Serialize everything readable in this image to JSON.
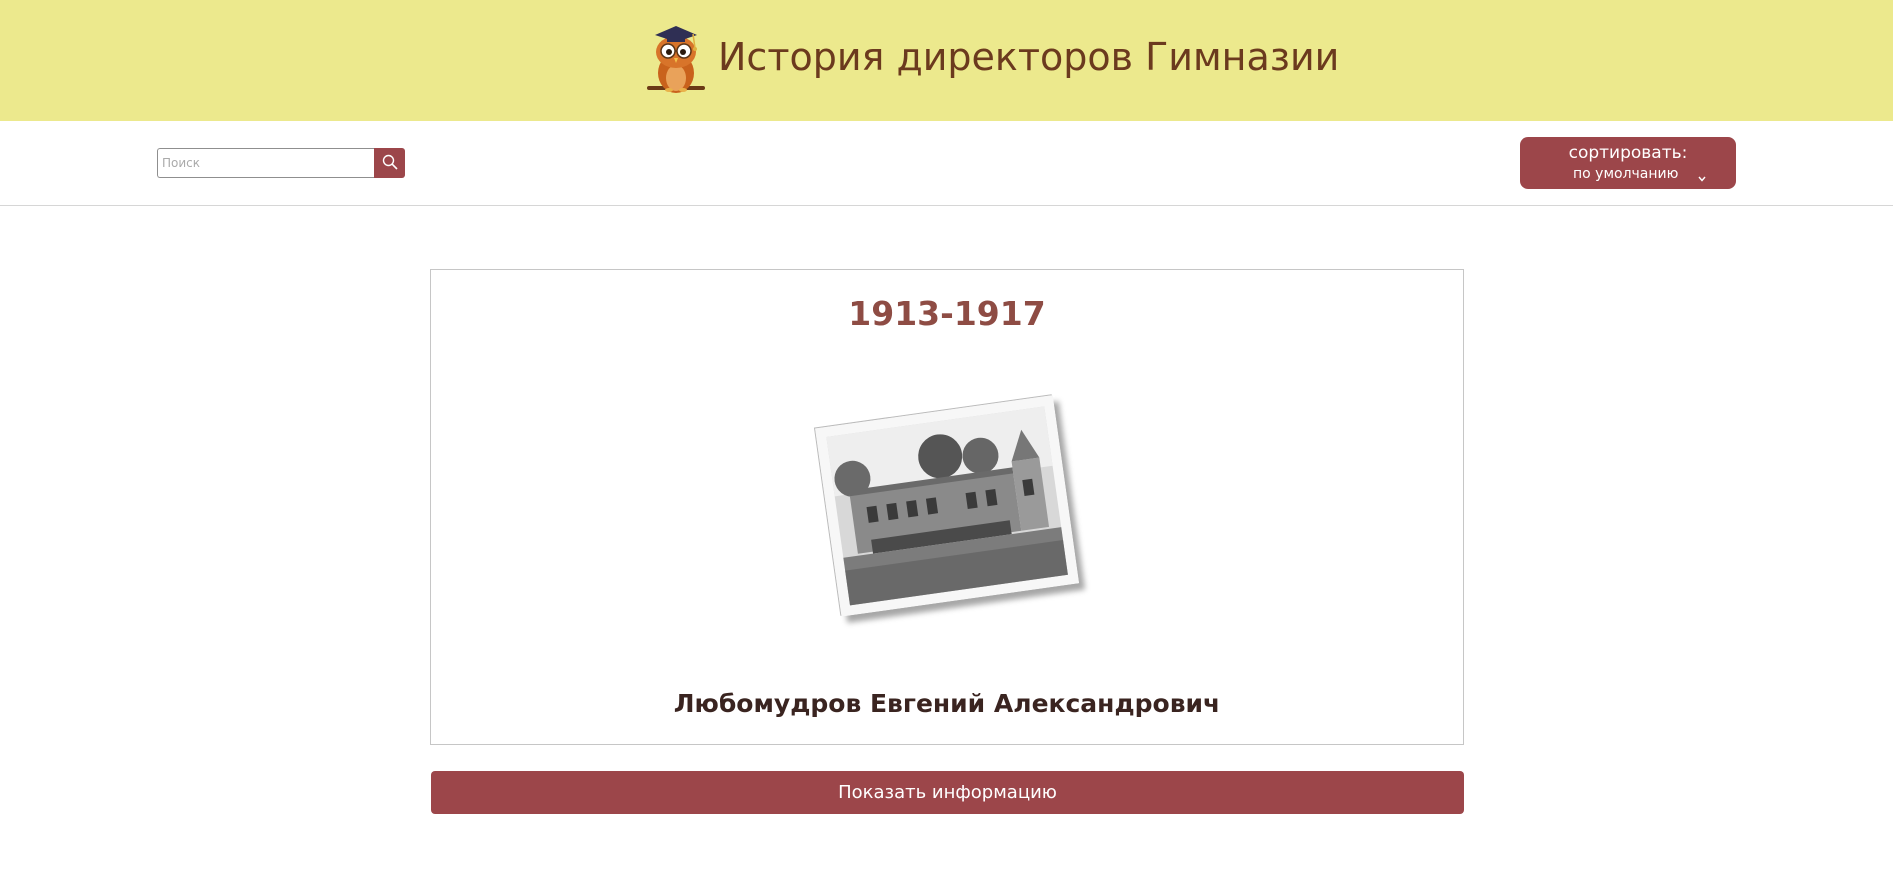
{
  "header": {
    "title": "История директоров Гимназии",
    "background_color": "#ece98d",
    "logo_icon": "owl-graduate-icon"
  },
  "toolbar": {
    "search_placeholder": "Поиск",
    "search_value": "",
    "search_icon": "magnifier-icon",
    "sort_label": "сортировать:",
    "sort_value": "по умолчанию",
    "sort_icon": "chevron-down-icon",
    "accent_color": "#9c464a"
  },
  "card": {
    "years": "1913-1917",
    "photo_icon": "school-building-photo",
    "name": "Любомудров Евгений Александрович",
    "years_color": "#8e4c44"
  },
  "actions": {
    "show_info_label": "Показать информацию"
  }
}
